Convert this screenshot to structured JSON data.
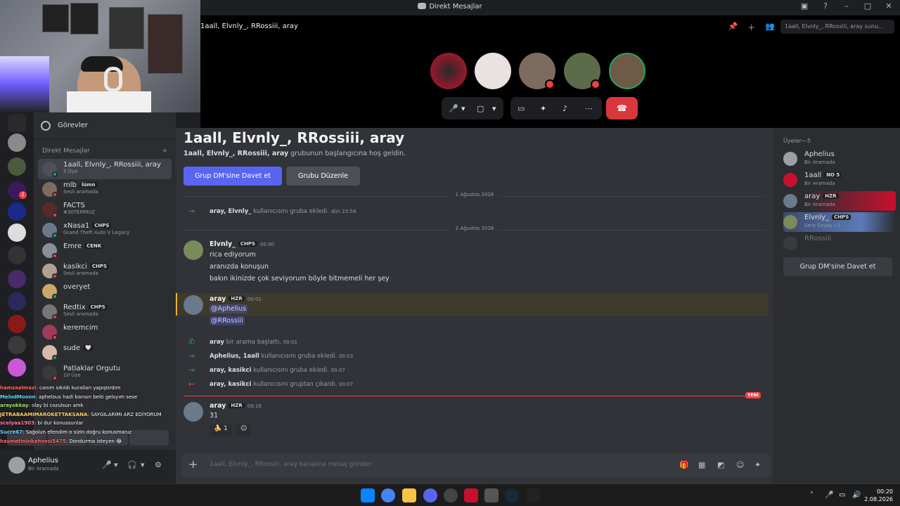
{
  "window": {
    "title": "Direkt Mesajlar"
  },
  "call": {
    "channel": "1aall, Elvnly_, RRossiii, aray",
    "search_placeholder": "1aall, Elvnly_, RRossiii, aray sunu..."
  },
  "sidebar": {
    "tasks": "Görevler",
    "dm_header": "Direkt Mesajlar",
    "items": [
      {
        "name": "1aall, Elvnly_, RRossiii, aray",
        "sub": "5 Üye",
        "active": true,
        "color": "#4e5058"
      },
      {
        "name": "mlb",
        "tag": "lümn",
        "sub": "Sesli aramada",
        "color": "#7d6b60"
      },
      {
        "name": "FACTS",
        "sub": "#30TEMMUZ",
        "color": "#5a2a2a"
      },
      {
        "name": "xNasa1",
        "tag": "CHPS",
        "sub": "Grand Theft Auto V Legacy",
        "color": "#6a7a8a"
      },
      {
        "name": "Emre",
        "tag": "CENK",
        "sub": "",
        "color": "#8a8f99"
      },
      {
        "name": "kasikci",
        "tag": "CHPS",
        "sub": "Sesli aramada",
        "color": "#b0a090"
      },
      {
        "name": "overyet",
        "sub": "",
        "color": "#c9a86a"
      },
      {
        "name": "Redtix",
        "tag": "CHPS",
        "sub": "Sesli aramada",
        "color": "#777"
      },
      {
        "name": "keremcim",
        "sub": "",
        "color": "#a23a5a"
      },
      {
        "name": "sude",
        "tag": "🤍",
        "sub": "",
        "color": "#d8b8a8"
      },
      {
        "name": "Patlaklar Orgutu",
        "sub": "10 Üye",
        "color": "#3a3a3a"
      }
    ]
  },
  "chat_overlay": [
    {
      "user": "hamzaalmazi",
      "text": ": canım sıkıldı kuralları yapıştırdım",
      "color": "#ff6b6b"
    },
    {
      "user": "MelodMoonn",
      "text": ": aphelous hadi barısın beiti gelsyım sese",
      "color": "#66d9ff"
    },
    {
      "user": "arayokkay",
      "text": ": olay bi cozulsun amk",
      "color": "#9ae66e"
    },
    {
      "user": "JETRABAAMIMAROKETTAKSANA",
      "text": ": SAYGILARIMI ARZ EDİYORUM",
      "color": "#ffd166"
    },
    {
      "user": "scelyaa1903",
      "text": ": bi dur konussunlar",
      "color": "#ff7aa2"
    },
    {
      "user": "Sucre67",
      "text": ": Sağolun efendim o sizin doğru konusmanız",
      "color": "#66d9ff"
    },
    {
      "user": "hasmetininkahvesi5475",
      "text": ": Dondurma isteyen 😂",
      "color": "#ff6b6b"
    }
  ],
  "user_panel": {
    "name": "Aphelius",
    "status": "Bir Aramada"
  },
  "main": {
    "title": "1aall, Elvnly_, RRossiii, aray",
    "welcome_bold": "1aall, Elvnly_, RRossiii, aray",
    "welcome_rest": " grubunun başlangıcına hoş geldin.",
    "invite_btn": "Grup DM'sine Davet et",
    "edit_btn": "Grubu Düzenle",
    "date1": "1 Ağustos 2026",
    "date2": "2 Ağustos 2026",
    "sys1_users": "aray, Elvnly_",
    "sys1_text": " kullanıcısını gruba ekledi.",
    "sys1_time": "dün 23:58",
    "msg1": {
      "name": "Elvnly_",
      "tag": "CHPS",
      "time": "00:00",
      "lines": [
        "rica ediyorum",
        "aranızda konuşun",
        "bakın ikinizde çok seviyorum böyle bitmemeli her şey"
      ]
    },
    "msg2": {
      "name": "aray",
      "tag": "HZR",
      "time": "00:01",
      "mentions": [
        "@Aphelius",
        "@RRossiii"
      ]
    },
    "sys2": {
      "user": "aray",
      "text": " bir arama başlattı.",
      "time": "00:01"
    },
    "sys3": {
      "user": "Aphelius, 1aall",
      "text": " kullanıcısını gruba ekledi.",
      "time": "00:03"
    },
    "sys4": {
      "user": "aray, kasikci",
      "text": " kullanıcısını gruba ekledi.",
      "time": "00:07"
    },
    "sys5": {
      "user": "aray, kasikci",
      "text": " kullanıcısını gruptan çıkardı.",
      "time": "00:07"
    },
    "new_label": "YENİ",
    "msg3": {
      "name": "aray",
      "tag": "HZR",
      "time": "00:18",
      "text": "31",
      "reaction_emoji": "🍌",
      "reaction_count": "1"
    },
    "composer_placeholder": "1aall, Elvnly_, RRossiii, aray kanalına mesaj gönder"
  },
  "members": {
    "header": "Üyeler—5",
    "list": [
      {
        "name": "Aphelius",
        "sub": "Bir Aramada",
        "color": "#9aa0a6"
      },
      {
        "name": "1aall",
        "tag": "NO 5",
        "sub": "Bir Aramada",
        "color": "#c8102e"
      },
      {
        "name": "aray",
        "tag": "HZR",
        "sub": "Bir Aramada",
        "color": "#6a7a8a"
      },
      {
        "name": "Elvnly_",
        "tag": "CHPS",
        "sub": "Sera Savaş +1",
        "color": "#7a8a5a"
      },
      {
        "name": "RRossiii",
        "sub": "",
        "color": "#4e5058"
      }
    ],
    "invite_btn": "Grup DM'sine Davet et"
  },
  "taskbar": {
    "time": "00:20",
    "date": "2.08.2026"
  }
}
